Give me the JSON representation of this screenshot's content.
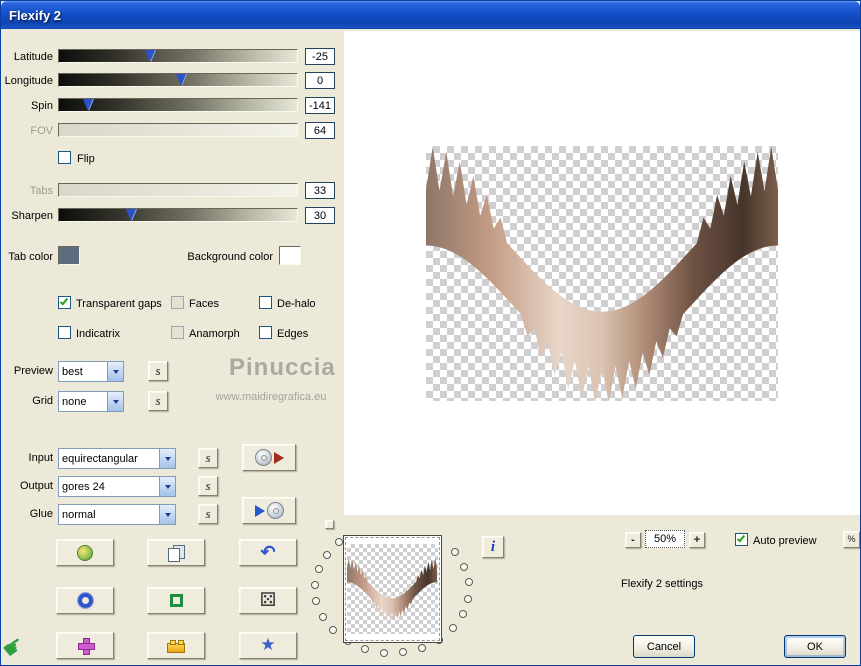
{
  "window": {
    "title": "Flexify 2"
  },
  "sliders": [
    {
      "label": "Latitude",
      "value": "-25"
    },
    {
      "label": "Longitude",
      "value": "0"
    },
    {
      "label": "Spin",
      "value": "-141"
    },
    {
      "label": "FOV",
      "value": "64"
    },
    {
      "label": "Tabs",
      "value": "33"
    },
    {
      "label": "Sharpen",
      "value": "30"
    }
  ],
  "checkboxes": {
    "flip": {
      "label": "Flip",
      "checked": false
    },
    "transparent_gaps": {
      "label": "Transparent gaps",
      "checked": true
    },
    "faces": {
      "label": "Faces",
      "checked": false
    },
    "de_halo": {
      "label": "De-halo",
      "checked": false
    },
    "indicatrix": {
      "label": "Indicatrix",
      "checked": false
    },
    "anamorph": {
      "label": "Anamorph",
      "checked": false
    },
    "edges": {
      "label": "Edges",
      "checked": false
    },
    "auto_preview": {
      "label": "Auto preview",
      "checked": true
    }
  },
  "colors": {
    "tab_color_label": "Tab color",
    "tab_color": "#5c6d7d",
    "background_color_label": "Background color",
    "background_color": "#ffffff"
  },
  "selects": {
    "preview": {
      "label": "Preview",
      "value": "best"
    },
    "grid": {
      "label": "Grid",
      "value": "none"
    },
    "input": {
      "label": "Input",
      "value": "equirectangular"
    },
    "output": {
      "label": "Output",
      "value": "gores 24"
    },
    "glue": {
      "label": "Glue",
      "value": "normal"
    }
  },
  "s_button_label": "s",
  "info_button_label": "i",
  "watermark": {
    "name": "Pinuccia",
    "site": "www.maidiregrafica.eu"
  },
  "zoom": {
    "minus": "-",
    "level": "50%",
    "plus": "+",
    "percent_button": "%"
  },
  "status_text": "Flexify 2 settings",
  "actions": {
    "cancel": "Cancel",
    "ok": "OK"
  },
  "icons": {
    "input_button": "cd-with-red-play",
    "glue_button": "blue-play-with-cd",
    "grid_buttons": [
      "sun-face",
      "page-copy",
      "undo-arrow",
      "blue-ring",
      "green-square",
      "dice",
      "purple-cross",
      "lego-brick",
      "blue-star"
    ],
    "corner": "green-hand",
    "thumbnail_ornament": "dotted-circle-ring"
  }
}
